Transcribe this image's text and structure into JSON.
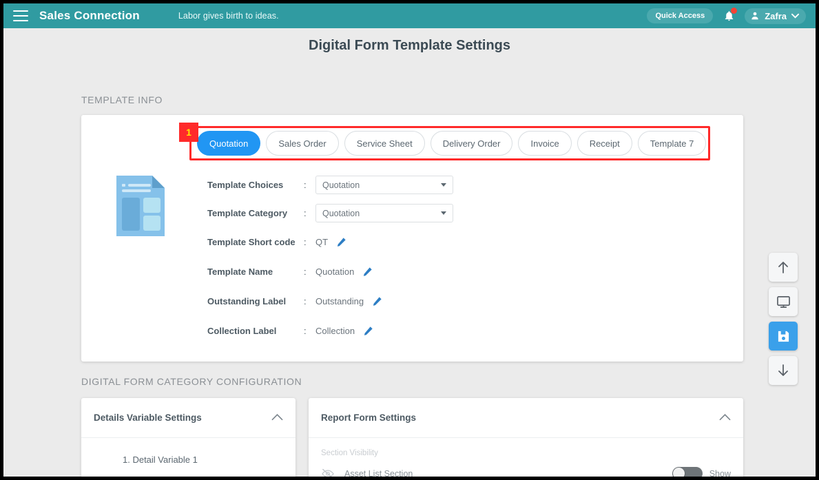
{
  "topbar": {
    "menu_icon": "hamburger-icon",
    "brand": "Sales Connection",
    "tagline": "Labor gives birth to ideas.",
    "quick_access_label": "Quick Access",
    "bell_icon": "notification-bell-icon",
    "user_name": "Zafra",
    "user_icon": "person-icon",
    "chevron": "⌄"
  },
  "page": {
    "title": "Digital Form Template Settings",
    "template_info_label": "TEMPLATE INFO",
    "category_config_label": "DIGITAL FORM CATEGORY CONFIGURATION"
  },
  "annotation": {
    "badge": "1",
    "color": "#ff2a2a",
    "badge_text_color": "#ffe600"
  },
  "tabs": [
    {
      "label": "Quotation",
      "active": true
    },
    {
      "label": "Sales Order",
      "active": false
    },
    {
      "label": "Service Sheet",
      "active": false
    },
    {
      "label": "Delivery Order",
      "active": false
    },
    {
      "label": "Invoice",
      "active": false
    },
    {
      "label": "Receipt",
      "active": false
    },
    {
      "label": "Template 7",
      "active": false
    }
  ],
  "template_form": {
    "doc_icon": "document-template-icon",
    "colon": ":",
    "rows": [
      {
        "label": "Template Choices",
        "value": "Quotation",
        "type": "select"
      },
      {
        "label": "Template Category",
        "value": "Quotation",
        "type": "select"
      },
      {
        "label": "Template Short code",
        "value": "QT",
        "type": "text"
      },
      {
        "label": "Template Name",
        "value": "Quotation",
        "type": "text"
      },
      {
        "label": "Outstanding Label",
        "value": "Outstanding",
        "type": "text"
      },
      {
        "label": "Collection Label",
        "value": "Collection",
        "type": "text"
      }
    ],
    "edit_icon": "pencil-icon"
  },
  "details_card": {
    "title": "Details Variable Settings",
    "collapse_icon": "chevron-up-icon",
    "items": [
      "1.   Detail Variable 1"
    ]
  },
  "report_card": {
    "title": "Report Form Settings",
    "collapse_icon": "chevron-up-icon",
    "section_visibility_label": "Section Visibility",
    "rows": [
      {
        "icon": "eye-off-icon",
        "name": "Asset List Section",
        "toggle_state": "off",
        "toggle_label": "Show"
      }
    ]
  },
  "fabs": [
    {
      "name": "scroll-up-button",
      "icon": "arrow-up-icon",
      "primary": false
    },
    {
      "name": "preview-button",
      "icon": "monitor-icon",
      "primary": false
    },
    {
      "name": "save-button",
      "icon": "save-icon",
      "primary": true
    },
    {
      "name": "scroll-down-button",
      "icon": "arrow-down-icon",
      "primary": false
    }
  ],
  "colors": {
    "header_teal": "#309ba1",
    "accent_blue": "#2196f3",
    "save_blue": "#3aa0ea",
    "page_bg": "#ebebeb"
  }
}
